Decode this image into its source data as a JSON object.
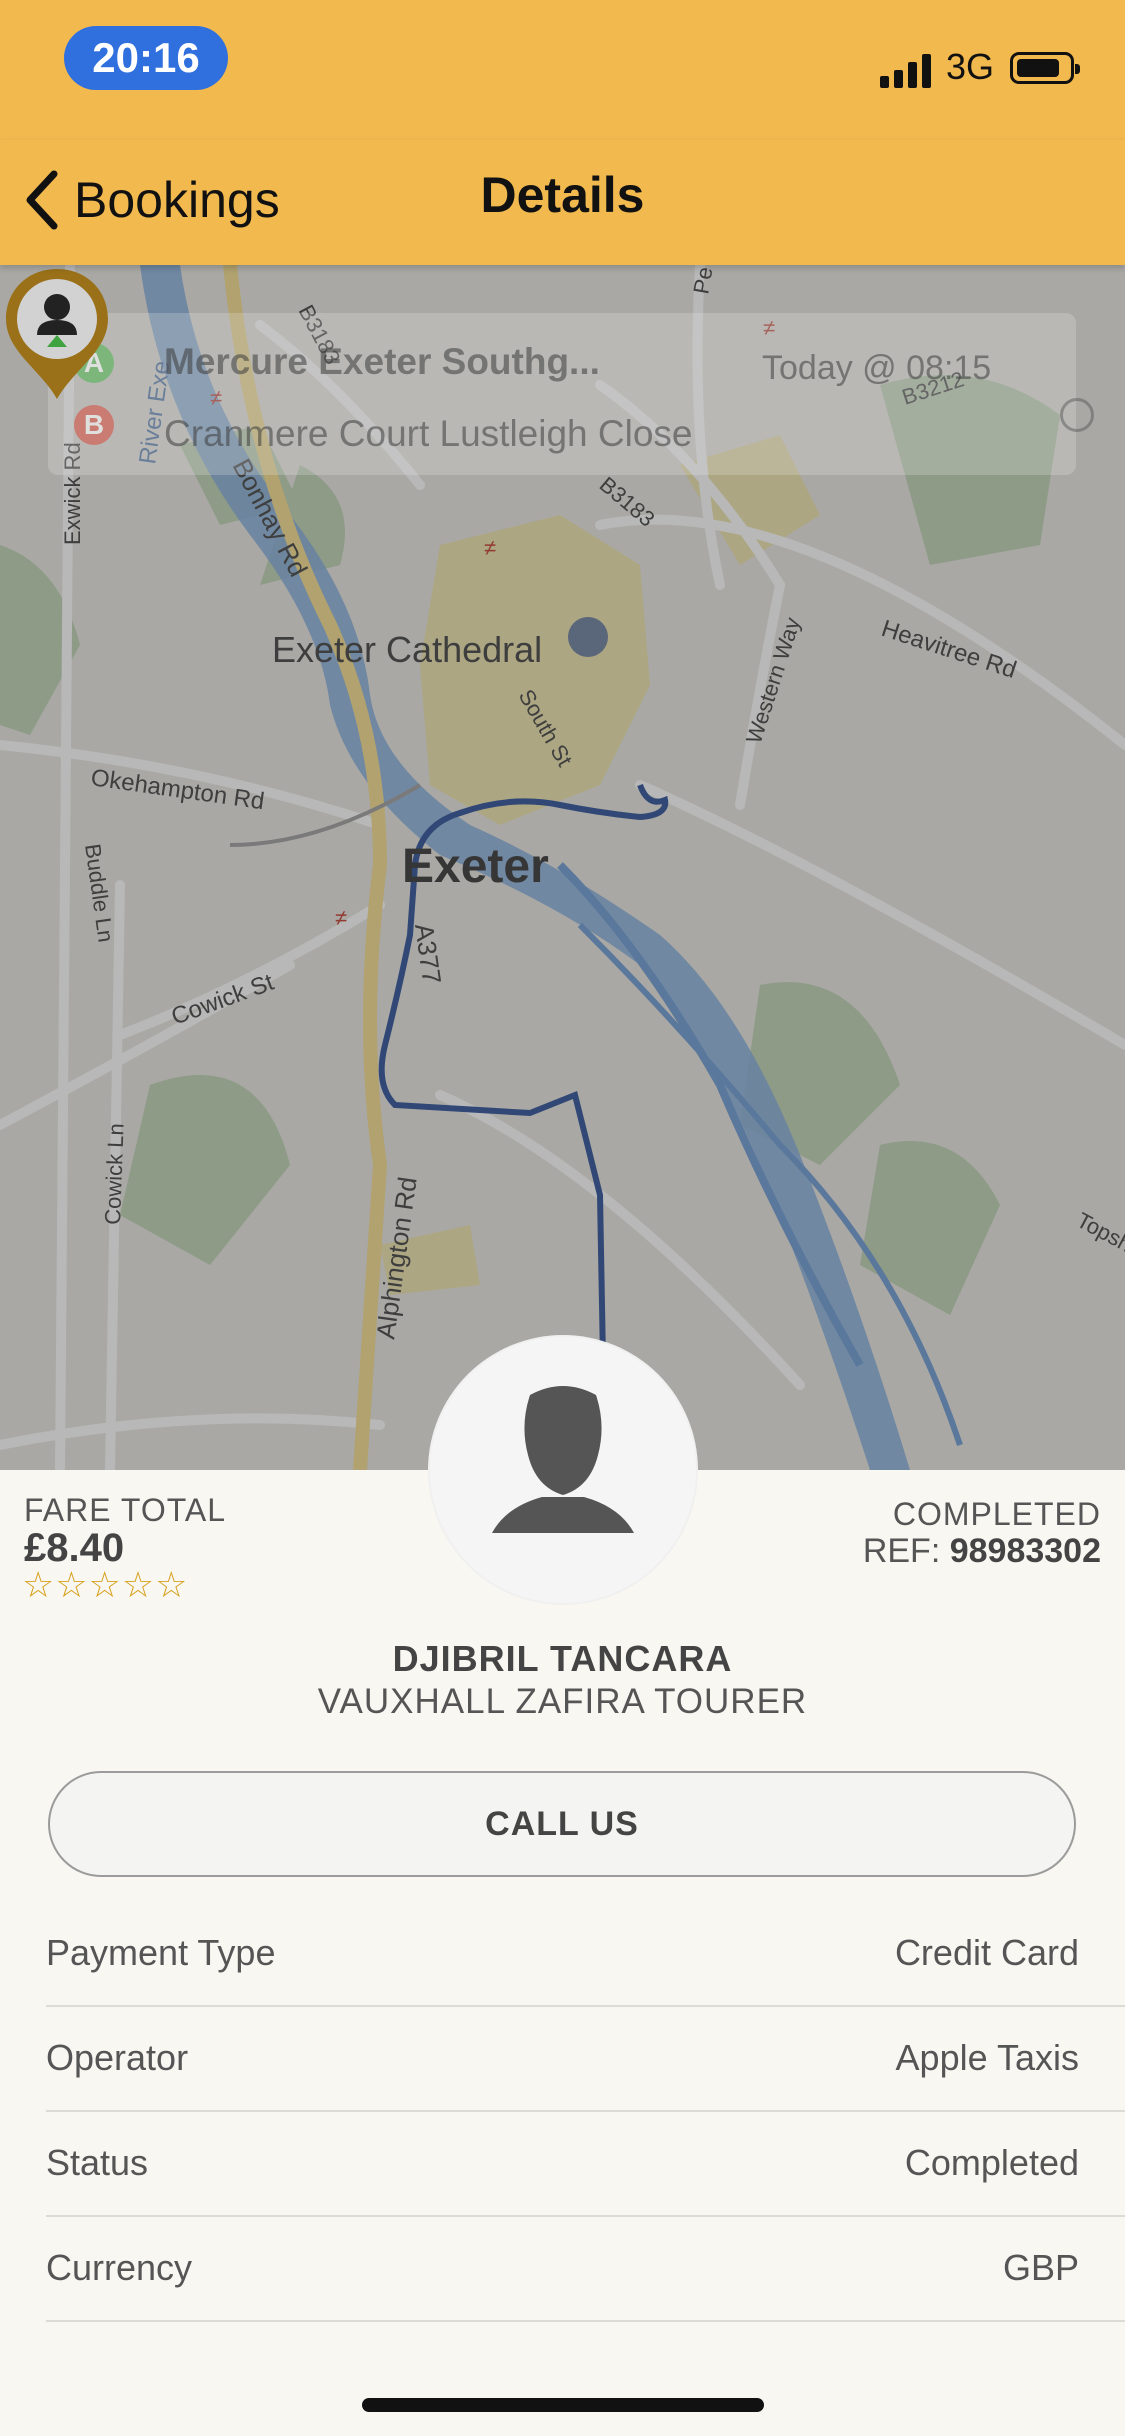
{
  "status_bar": {
    "time": "20:16",
    "network": "3G"
  },
  "nav": {
    "back_label": "Bookings",
    "title": "Details"
  },
  "trip": {
    "pickup_marker": "A",
    "pickup": "Mercure Exeter Southg...",
    "pickup_time": "Today @ 08:15",
    "dropoff_marker": "B",
    "dropoff": "Cranmere Court Lustleigh Close"
  },
  "map": {
    "city": "Exeter",
    "labels": {
      "cathedral": "Exeter Cathedral",
      "bonhay": "Bonhay Rd",
      "river_exe": "River Exe",
      "exwick": "Exwick Rd",
      "okehampton": "Okehampton Rd",
      "cowick_st": "Cowick St",
      "budle": "Buddle Ln",
      "cowick_ln": "Cowick Ln",
      "alphington": "Alphington Rd",
      "a377": "A377",
      "south_st": "South St",
      "western_way": "Western Way",
      "heavitree": "Heavitree Rd",
      "b3183a": "B3183",
      "b3183b": "B3183",
      "b3212": "B3212",
      "topsham": "Topsh",
      "pe": "Pe"
    },
    "colors": {
      "route": "#2c4f95",
      "river": "#7ea8d8",
      "marker": "#9a7118"
    }
  },
  "fare": {
    "label": "FARE TOTAL",
    "amount": "£8.40",
    "stars": "☆☆☆☆☆",
    "rating": 0
  },
  "booking": {
    "status": "COMPLETED",
    "ref_label": "REF:",
    "ref_number": "98983302"
  },
  "driver": {
    "name": "DJIBRIL TANCARA",
    "vehicle": "VAUXHALL ZAFIRA TOURER"
  },
  "call_button": "CALL US",
  "rows": [
    {
      "label": "Payment Type",
      "value": "Credit Card"
    },
    {
      "label": "Operator",
      "value": "Apple Taxis"
    },
    {
      "label": "Status",
      "value": "Completed"
    },
    {
      "label": "Currency",
      "value": "GBP"
    }
  ]
}
